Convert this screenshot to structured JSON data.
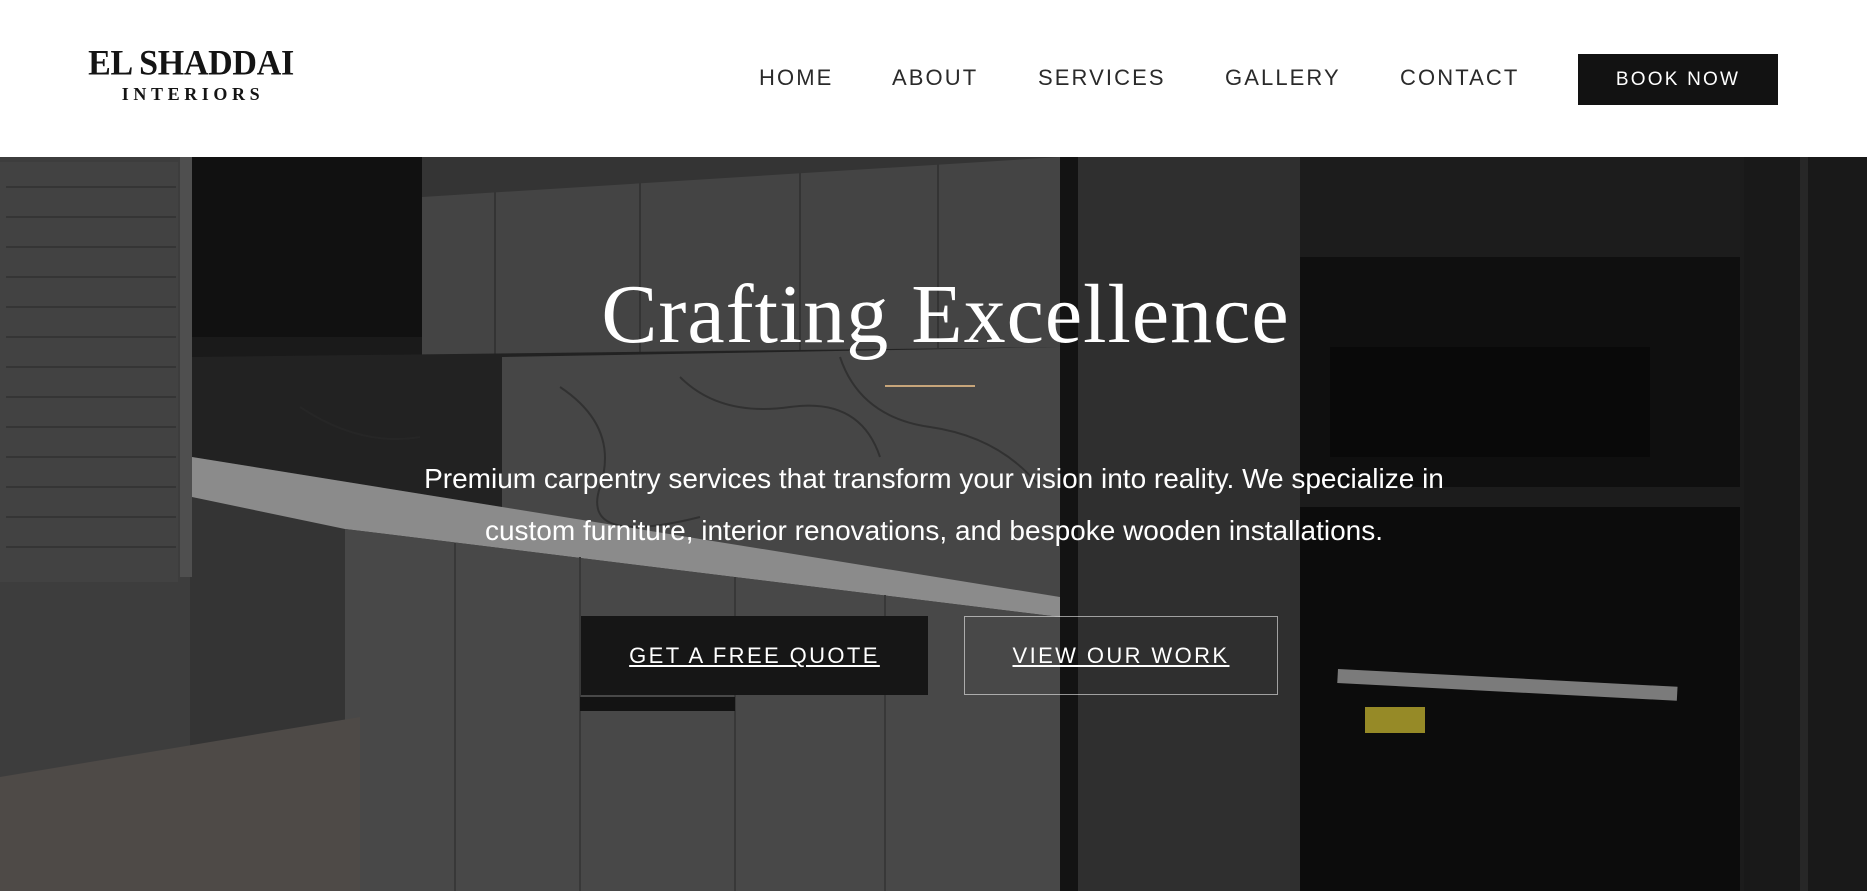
{
  "brand": {
    "name": "EL SHADDAI",
    "tagline": "INTERIORS"
  },
  "nav": {
    "items": [
      {
        "label": "HOME"
      },
      {
        "label": "ABOUT"
      },
      {
        "label": "SERVICES"
      },
      {
        "label": "GALLERY"
      },
      {
        "label": "CONTACT"
      }
    ],
    "cta_label": "BOOK NOW"
  },
  "hero": {
    "title": "Crafting Excellence",
    "description": "Premium carpentry services that transform your vision into reality. We specialize in custom furniture, interior renovations, and bespoke wooden installations.",
    "primary_button": "GET A FREE QUOTE",
    "secondary_button": "VIEW OUR WORK",
    "background_image": "modern-dark-kitchen-photo"
  },
  "colors": {
    "header_bg": "#ffffff",
    "text_dark": "#2a2a2a",
    "button_dark": "#121212",
    "accent_gold": "#c7a57a",
    "hero_text": "#ffffff"
  }
}
